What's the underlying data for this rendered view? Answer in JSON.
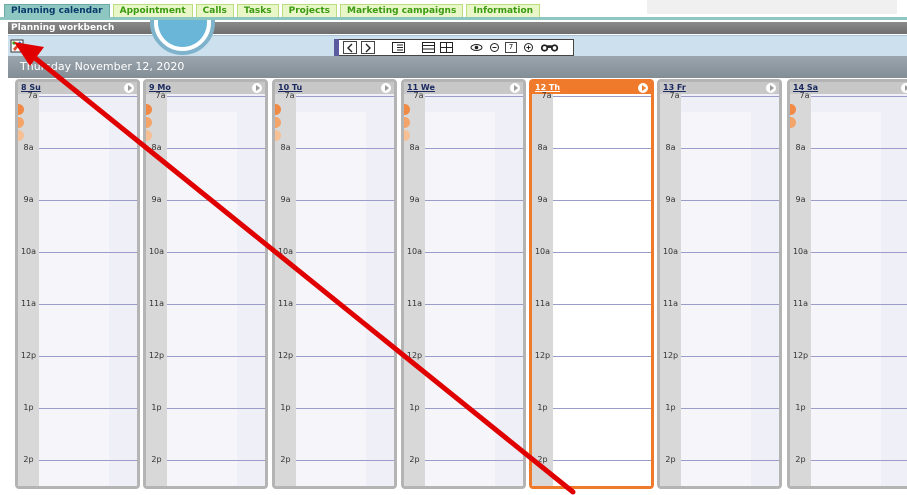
{
  "tabs": [
    {
      "label": "Planning calendar",
      "active": true
    },
    {
      "label": "Appointment",
      "active": false
    },
    {
      "label": "Calls",
      "active": false
    },
    {
      "label": "Tasks",
      "active": false
    },
    {
      "label": "Projects",
      "active": false
    },
    {
      "label": "Marketing campaigns",
      "active": false
    },
    {
      "label": "Information",
      "active": false
    }
  ],
  "workbench": {
    "title": "Planning workbench"
  },
  "toolbar": {
    "icons": [
      "edit-icon",
      "prev-arrow-icon",
      "next-arrow-icon",
      "list-view-icon",
      "grid-view-icon",
      "eye-icon",
      "minus-icon",
      "plus-icon",
      "binoculars-icon"
    ],
    "days_count": "7"
  },
  "date_banner": {
    "text": "Thursday November 12, 2020"
  },
  "days": [
    {
      "label": "8 Su",
      "today": false
    },
    {
      "label": "9 Mo",
      "today": false
    },
    {
      "label": "10 Tu",
      "today": false
    },
    {
      "label": "11 We",
      "today": false
    },
    {
      "label": "12 Th",
      "today": true
    },
    {
      "label": "13 Fr",
      "today": false
    },
    {
      "label": "14 Sa",
      "today": false
    }
  ],
  "hours": [
    "7a",
    "8a",
    "9a",
    "10a",
    "11a",
    "12p",
    "1p",
    "2p"
  ],
  "colors": {
    "today_accent": "#f07a2c",
    "tab_active": "#8ec7c2",
    "tab_inactive_text": "#3a9a10",
    "annotation_arrow": "#e00000"
  }
}
